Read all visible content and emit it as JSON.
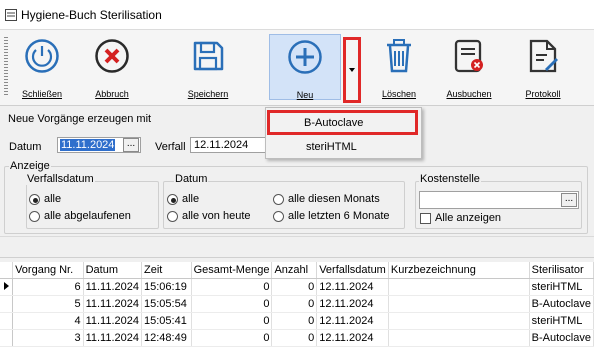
{
  "window": {
    "title": "Hygiene-Buch Sterilisation"
  },
  "toolbar": {
    "buttons": [
      {
        "label": "Schließen",
        "icon": "power-icon"
      },
      {
        "label": "Abbruch",
        "icon": "cancel-icon"
      },
      {
        "label": "Speichern",
        "icon": "save-icon"
      },
      {
        "label": "Neu",
        "icon": "plus-icon"
      },
      {
        "label": "Löschen",
        "icon": "trash-icon"
      },
      {
        "label": "Ausbuchen",
        "icon": "checkout-icon"
      },
      {
        "label": "Protokoll",
        "icon": "protocol-icon"
      }
    ]
  },
  "dropdown": {
    "items": [
      "B-Autoclave",
      "steriHTML"
    ]
  },
  "create": {
    "legend": "Neue Vorgänge erzeugen mit",
    "datum_label": "Datum",
    "datum_value": "11.11.2024",
    "verfall_label": "Verfall",
    "verfall_value": "12.11.2024",
    "ellipsis": "..."
  },
  "anzeige": {
    "legend": "Anzeige",
    "verfall_group": {
      "legend": "Verfallsdatum",
      "opt1": "alle",
      "opt2": "alle abgelaufenen"
    },
    "datum_group": {
      "legend": "Datum",
      "opt1": "alle",
      "opt2": "alle von heute",
      "opt3": "alle diesen Monats",
      "opt4": "alle letzten 6 Monate"
    },
    "kosten_group": {
      "legend": "Kostenstelle",
      "ellipsis": "...",
      "checkbox_label": "Alle anzeigen"
    }
  },
  "table": {
    "columns": [
      "Vorgang Nr.",
      "Datum",
      "Zeit",
      "Gesamt-Menge",
      "Anzahl",
      "Verfallsdatum",
      "Kurzbezeichnung",
      "Sterilisator"
    ],
    "rows": [
      [
        "6",
        "11.11.2024",
        "15:06:19",
        "0",
        "0",
        "12.11.2024",
        "",
        "steriHTML"
      ],
      [
        "5",
        "11.11.2024",
        "15:05:54",
        "0",
        "0",
        "12.11.2024",
        "",
        "B-Autoclave"
      ],
      [
        "4",
        "11.11.2024",
        "15:05:41",
        "0",
        "0",
        "12.11.2024",
        "",
        "steriHTML"
      ],
      [
        "3",
        "11.11.2024",
        "12:48:49",
        "0",
        "0",
        "12.11.2024",
        "",
        "B-Autoclave"
      ]
    ]
  },
  "colors": {
    "highlight": "#e02828",
    "selection": "#2f6fcc",
    "icon": "#2a6fb8",
    "cancel": "#d42020"
  }
}
